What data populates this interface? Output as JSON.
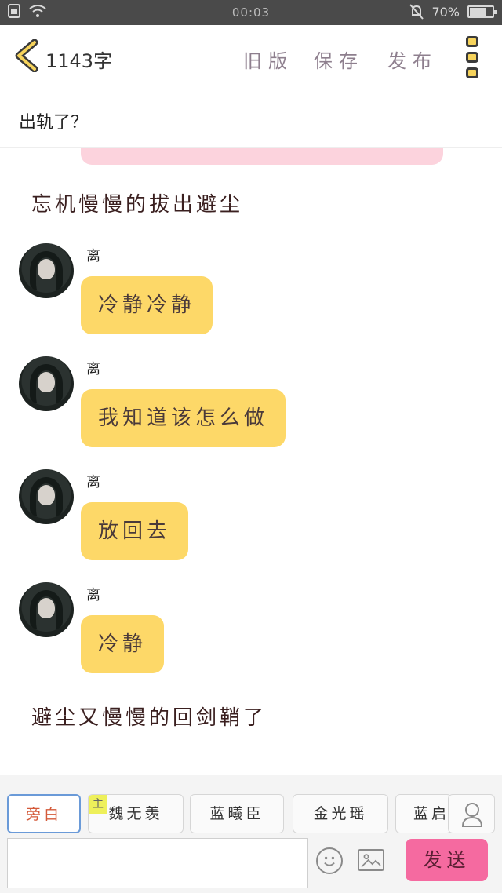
{
  "status_bar": {
    "time": "00:03",
    "battery": "70%"
  },
  "header": {
    "word_count": "1143字",
    "old_version_label": "旧版",
    "save_label": "保存",
    "publish_label": "发布"
  },
  "title": "出轨了？",
  "chat": {
    "narrations": [
      "忘机慢慢的拔出避尘",
      "避尘又慢慢的回剑鞘了"
    ],
    "messages": [
      {
        "sender": "离",
        "text": "冷静冷静"
      },
      {
        "sender": "离",
        "text": "我知道该怎么做"
      },
      {
        "sender": "离",
        "text": "放回去"
      },
      {
        "sender": "离",
        "text": "冷静"
      }
    ]
  },
  "roles": {
    "items": [
      "旁白",
      "魏无羡",
      "蓝曦臣",
      "金光瑶",
      "蓝启"
    ],
    "main_badge": "主"
  },
  "composer": {
    "placeholder": "",
    "send_label": "发送"
  },
  "colors": {
    "bubble": "#fdd868",
    "send": "#f56aa0",
    "pink_bubble": "#fcd3dd"
  }
}
